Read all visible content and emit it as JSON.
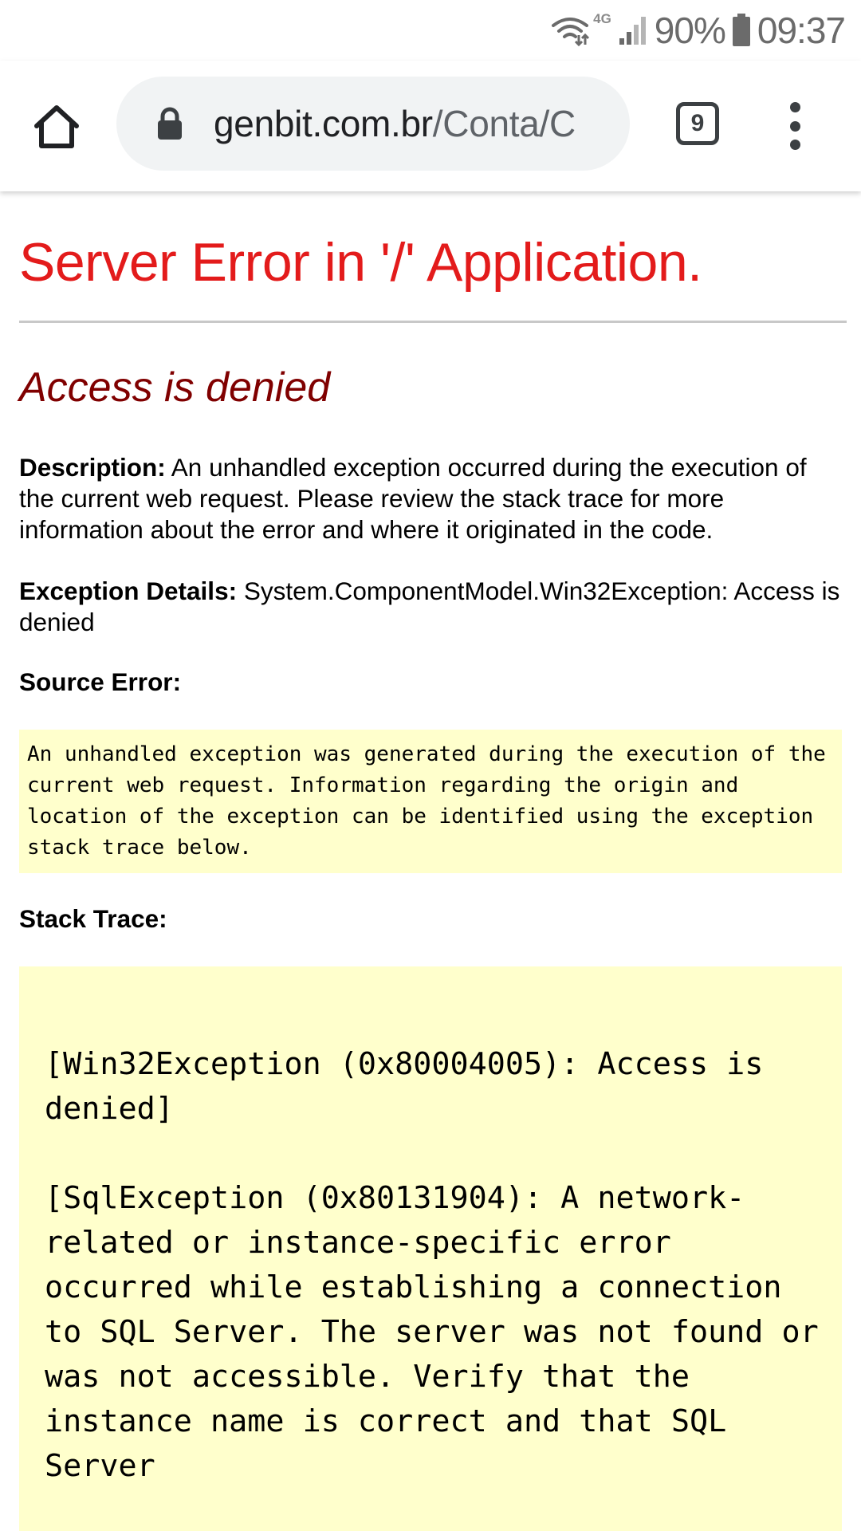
{
  "status_bar": {
    "network_type": "4G",
    "battery": "90%",
    "time": "09:37"
  },
  "toolbar": {
    "url_domain": "genbit.com.br",
    "url_path": "/Conta/C",
    "tab_count": "9"
  },
  "page": {
    "title": "Server Error in '/' Application.",
    "error_heading": "Access is denied",
    "description_label": "Description:",
    "description_text": " An unhandled exception occurred during the execution of the current web request. Please review the stack trace for more information about the error and where it originated in the code.",
    "exception_label": "Exception Details:",
    "exception_text": " System.ComponentModel.Win32Exception: Access is denied",
    "source_error_label": "Source Error:",
    "source_error_text": "An unhandled exception was generated during the execution of the current web request. Information regarding the origin and location of the exception can be identified using the exception stack trace below.",
    "stack_trace_label": "Stack Trace:",
    "stack_trace_1": "[Win32Exception (0x80004005): Access is denied]",
    "stack_trace_2": "[SqlException (0x80131904): A network-related or instance-specific error occurred while establishing a connection to SQL Server. The server was not found or was not accessible. Verify that the instance name is correct and that SQL Server"
  }
}
